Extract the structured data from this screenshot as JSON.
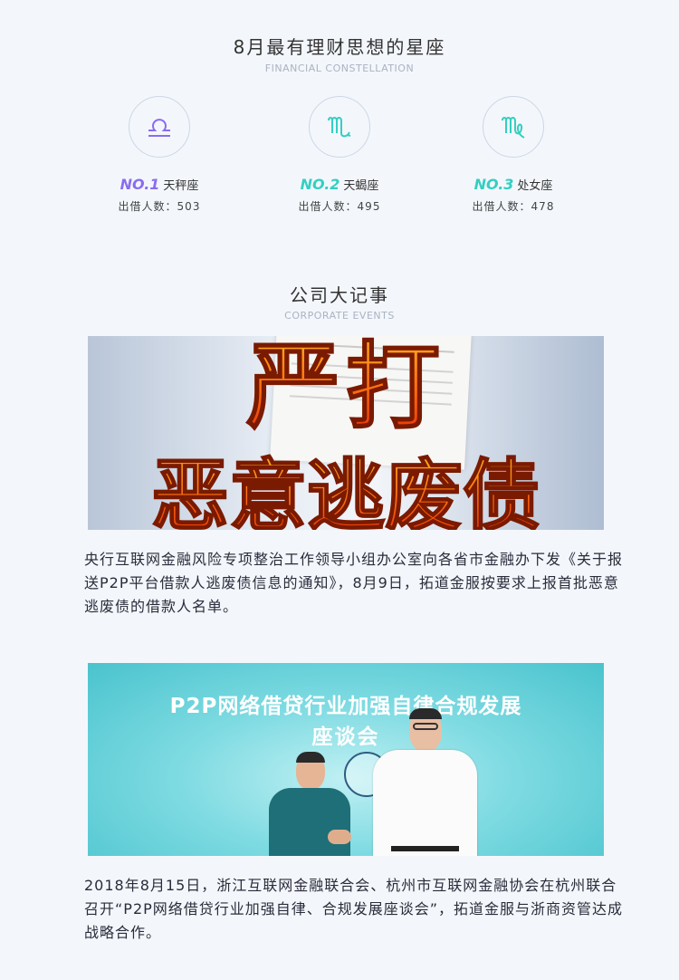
{
  "section1": {
    "title": "8月最有理财思想的星座",
    "subtitle": "FINANCIAL CONSTELLATION",
    "items": [
      {
        "rank": "NO.1",
        "sign": "天秤座",
        "count_label": "出借人数：503",
        "color": "#8b6cf0",
        "icon": "libra-icon"
      },
      {
        "rank": "NO.2",
        "sign": "天蝎座",
        "count_label": "出借人数：495",
        "color": "#33cfc1",
        "icon": "scorpio-icon"
      },
      {
        "rank": "NO.3",
        "sign": "处女座",
        "count_label": "出借人数：478",
        "color": "#33cfc1",
        "icon": "virgo-icon"
      }
    ]
  },
  "section2": {
    "title": "公司大记事",
    "subtitle": "CORPORATE EVENTS"
  },
  "event1": {
    "banner_line1": "严打",
    "banner_line2": "恶意逃废债",
    "text": "央行互联网金融风险专项整治工作领导小组办公室向各省市金融办下发《关于报送P2P平台借款人逃废债信息的通知》，8月9日，拓道金服按要求上报首批恶意逃废债的借款人名单。"
  },
  "event2": {
    "banner_line1": "P2P网络借贷行业加强自律合规发展",
    "banner_line2": "座谈会",
    "text": "2018年8月15日，浙江互联网金融联合会、杭州市互联网金融协会在杭州联合召开“P2P网络借贷行业加强自律、合规发展座谈会”，拓道金服与浙商资管达成战略合作。"
  }
}
